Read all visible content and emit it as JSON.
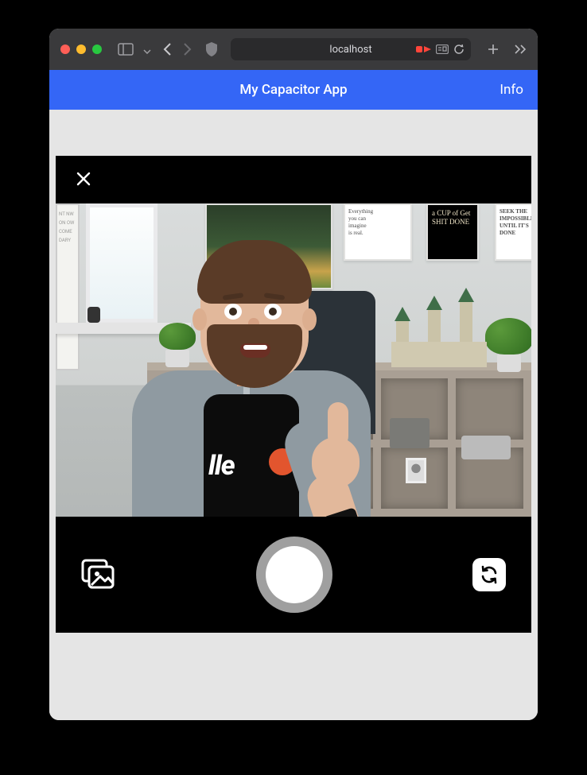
{
  "browser": {
    "url_display": "localhost"
  },
  "app": {
    "title": "My Capacitor App",
    "info_label": "Info"
  },
  "posters": {
    "imagine": "Everything\nyou can\nimagine\nis real.",
    "cup": "a CUP of Get SHIT DONE",
    "seek": "SEEK THE IMPOSSIBLE UNTIL IT'S DONE",
    "left_frame": "NT NW ON OW COME DARY"
  },
  "tee_text": "lle",
  "icons": {
    "close": "close-icon",
    "gallery": "gallery-icon",
    "shutter": "shutter-icon",
    "flip": "flip-camera-icon",
    "traffic_red": "traffic-close-icon",
    "traffic_yel": "traffic-minimize-icon",
    "traffic_grn": "traffic-zoom-icon",
    "sidebar": "sidebar-toggle-icon",
    "back": "nav-back-icon",
    "fwd": "nav-forward-icon",
    "shield": "privacy-shield-icon",
    "recording": "recording-indicator-icon",
    "reader": "reader-icon",
    "reload": "reload-icon",
    "add_tab": "new-tab-icon",
    "overflow": "tab-overflow-icon"
  }
}
